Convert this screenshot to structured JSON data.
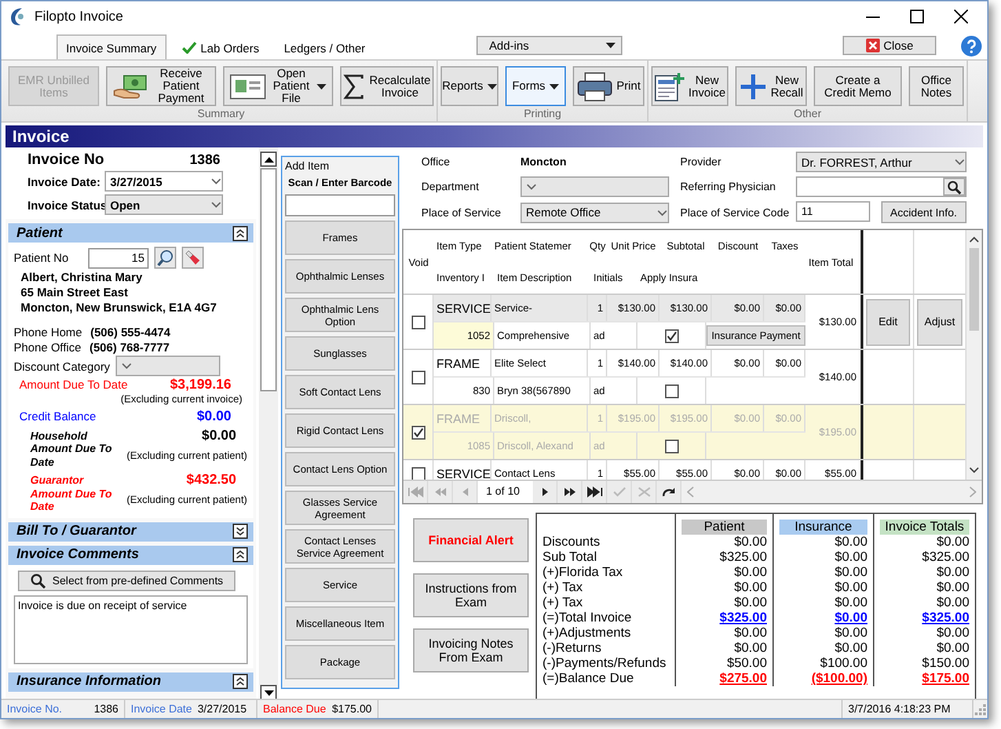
{
  "window": {
    "title": "Filopto Invoice"
  },
  "tabs": [
    {
      "label": "Invoice Summary",
      "selected": true,
      "complete": false
    },
    {
      "label": "Lab Orders",
      "selected": false,
      "complete": true
    },
    {
      "label": "Ledgers / Other",
      "selected": false,
      "complete": false
    }
  ],
  "addins_menu": {
    "value": "Add-ins"
  },
  "close_button": {
    "label": "Close"
  },
  "ribbon": [
    {
      "label": "Summary",
      "buttons": [
        {
          "label": "EMR Unbilled Items",
          "kind": "text",
          "disabled": true,
          "focused": false
        },
        {
          "label": "Receive Patient Payment",
          "kind": "icon",
          "disabled": false,
          "focused": false
        },
        {
          "label": "Open Patient File",
          "kind": "split",
          "disabled": false,
          "focused": false
        },
        {
          "label": "Recalculate Invoice",
          "kind": "icon",
          "disabled": false,
          "focused": false
        }
      ]
    },
    {
      "label": "Printing",
      "buttons": [
        {
          "label": "Reports",
          "kind": "menu",
          "disabled": false,
          "focused": false
        },
        {
          "label": "Forms",
          "kind": "menu",
          "disabled": false,
          "focused": true
        },
        {
          "label": "Print",
          "kind": "icon",
          "disabled": false,
          "focused": false
        }
      ]
    },
    {
      "label": "Other",
      "buttons": [
        {
          "label": "New Invoice",
          "kind": "icon",
          "disabled": false,
          "focused": false
        },
        {
          "label": "New Recall",
          "kind": "icon",
          "disabled": false,
          "focused": false
        },
        {
          "label": "Create a Credit Memo",
          "kind": "text",
          "disabled": false,
          "focused": false
        },
        {
          "label": "Office Notes",
          "kind": "text",
          "disabled": false,
          "focused": false
        }
      ]
    }
  ],
  "invoice": {
    "title": "Invoice",
    "invoice_no": {
      "label": "Invoice No",
      "value": "1386"
    },
    "invoice_date": {
      "label": "Invoice Date:",
      "value": "3/27/2015"
    },
    "invoice_status": {
      "label": "Invoice Status",
      "value": "Open"
    }
  },
  "patient": {
    "title": "Patient",
    "expanded": true,
    "patient_no": {
      "label": "Patient No",
      "value": "15"
    },
    "address": [
      "Albert, Christina Mary",
      "65 Main Street East",
      "Moncton, New Brunswick, E1A 4G7"
    ],
    "phones": [
      {
        "label": "Phone Home",
        "value": "(506) 555-4474"
      },
      {
        "label": "Phone Office",
        "value": "(506) 768-7777"
      }
    ],
    "discount_category": {
      "label": "Discount Category"
    },
    "balances": [
      {
        "label": "Amount Due To Date",
        "value": "$3,199.16",
        "note": "(Excluding current invoice)",
        "color": "#ff0000",
        "kind": "plain"
      },
      {
        "label": "Credit Balance",
        "value": "$0.00",
        "color": "#0000ff",
        "kind": "plain"
      },
      {
        "label": "Household Amount Due To Date",
        "value": "$0.00",
        "note": "(Excluding current patient)",
        "color": "#000000",
        "kind": "emphasis"
      },
      {
        "label": "Guarantor Amount Due To Date",
        "value": "$432.50",
        "note": "(Excluding current patient)",
        "color": "#ff0000",
        "kind": "emphasis"
      }
    ]
  },
  "sections": [
    {
      "title": "Bill To / Guarantor",
      "expanded": false
    },
    {
      "title": "Invoice Comments",
      "expanded": true,
      "button": "Select from pre-defined Comments",
      "comment": "Invoice is due on receipt of service"
    },
    {
      "title": "Insurance Information",
      "expanded": true
    }
  ],
  "add_item": {
    "legend": "Add Item",
    "barcode_label": "Scan / Enter Barcode",
    "buttons": [
      "Frames",
      "Ophthalmic Lenses",
      "Ophthalmic Lens Option",
      "Sunglasses",
      "Soft Contact Lens",
      "Rigid Contact Lens",
      "Contact Lens Option",
      "Glasses Service Agreement",
      "Contact Lenses Service Agreement",
      "Service",
      "Miscellaneous Item",
      "Package"
    ]
  },
  "office": {
    "label": "Office",
    "value": "Moncton"
  },
  "department": {
    "label": "Department"
  },
  "place_of_service": {
    "label": "Place of Service",
    "value": "Remote Office"
  },
  "provider": {
    "label": "Provider",
    "value": "Dr. FORREST, Arthur"
  },
  "referring_physician": {
    "label": "Referring Physician"
  },
  "place_of_service_code": {
    "label": "Place of Service Code",
    "value": "11"
  },
  "accident_button": "Accident Info.",
  "items_grid": {
    "columns": [
      "Void",
      "Item Type",
      "Patient Statemer",
      "Qty",
      "Unit Price",
      "Subtotal",
      "Discount",
      "Taxes",
      "Item Total"
    ],
    "subcolumns": [
      "Inventory I",
      "Item Description",
      "Initials",
      "Apply Insura"
    ],
    "rows": [
      {
        "void": false,
        "selected": true,
        "item_type": "SERVICE",
        "statement": "Service-",
        "qty": "1",
        "unit_price": "$130.00",
        "subtotal": "$130.00",
        "discount": "$0.00",
        "taxes": "$0.00",
        "inventory_no": "1052",
        "description": "Comprehensive",
        "initials": "ad",
        "apply_insurance": true,
        "insurance_button": "Insurance Payment",
        "item_total": "$130.00",
        "actions": [
          "Edit",
          "Adjust"
        ]
      },
      {
        "void": false,
        "selected": false,
        "item_type": "FRAME",
        "statement": "Elite Select",
        "qty": "1",
        "unit_price": "$140.00",
        "subtotal": "$140.00",
        "discount": "$0.00",
        "taxes": "$0.00",
        "inventory_no": "830",
        "description": "Bryn 38(567890",
        "initials": "ad",
        "apply_insurance": false,
        "item_total": "$140.00"
      },
      {
        "void": true,
        "selected": false,
        "item_type": "FRAME",
        "statement": "Driscoll,",
        "qty": "1",
        "unit_price": "$195.00",
        "subtotal": "$195.00",
        "discount": "$0.00",
        "taxes": "$0.00",
        "inventory_no": "1085",
        "description": "Driscoll, Alexand",
        "initials": "ad",
        "apply_insurance": false,
        "item_total": "$195.00"
      },
      {
        "void": false,
        "selected": false,
        "item_type": "SERVICE",
        "statement": "Contact Lens",
        "qty": "1",
        "unit_price": "$55.00",
        "subtotal": "$55.00",
        "discount": "$0.00",
        "taxes": "$0.00",
        "item_total": "$55.00"
      }
    ],
    "pager": {
      "position": "1 of 10"
    }
  },
  "side_buttons": [
    {
      "label": "Financial Alert",
      "kind": "alert"
    },
    {
      "label": "Instructions from Exam",
      "kind": "normal"
    },
    {
      "label": "Invoicing Notes From Exam",
      "kind": "normal"
    }
  ],
  "totals": {
    "columns": [
      {
        "label": "Patient",
        "color": "#c8c8c8"
      },
      {
        "label": "Insurance",
        "color": "#a9cbf0"
      },
      {
        "label": "Invoice Totals",
        "color": "#c4e2c4"
      }
    ],
    "rows": [
      {
        "label": "Discounts",
        "values": [
          "$0.00",
          "$0.00",
          "$0.00"
        ],
        "kind": "plain"
      },
      {
        "label": "Sub Total",
        "values": [
          "$325.00",
          "$0.00",
          "$325.00"
        ],
        "kind": "plain"
      },
      {
        "label": "(+)Florida Tax",
        "values": [
          "$0.00",
          "$0.00",
          "$0.00"
        ],
        "kind": "plain"
      },
      {
        "label": "(+) Tax",
        "values": [
          "$0.00",
          "$0.00",
          "$0.00"
        ],
        "kind": "plain"
      },
      {
        "label": "(+) Tax",
        "values": [
          "$0.00",
          "$0.00",
          "$0.00"
        ],
        "kind": "plain"
      },
      {
        "label": "(=)Total Invoice",
        "values": [
          "$325.00",
          "$0.00",
          "$325.00"
        ],
        "kind": "link"
      },
      {
        "label": "(+)Adjustments",
        "values": [
          "$0.00",
          "$0.00",
          "$0.00"
        ],
        "kind": "plain"
      },
      {
        "label": "(-)Returns",
        "values": [
          "$0.00",
          "$0.00",
          "$0.00"
        ],
        "kind": "plain"
      },
      {
        "label": "(-)Payments/Refunds",
        "values": [
          "$50.00",
          "$100.00",
          "$150.00"
        ],
        "kind": "plain"
      },
      {
        "label": "(=)Balance Due",
        "values": [
          "$275.00",
          "($100.00)",
          "$175.00"
        ],
        "kind": "due"
      }
    ]
  },
  "status_bar": {
    "invoice_no": {
      "label": "Invoice No.",
      "value": "1386"
    },
    "invoice_date": {
      "label": "Invoice Date",
      "value": "3/27/2015"
    },
    "balance_due": {
      "label": "Balance Due",
      "value": "$175.00"
    },
    "timestamp": "3/7/2016 4:18:23 PM"
  }
}
